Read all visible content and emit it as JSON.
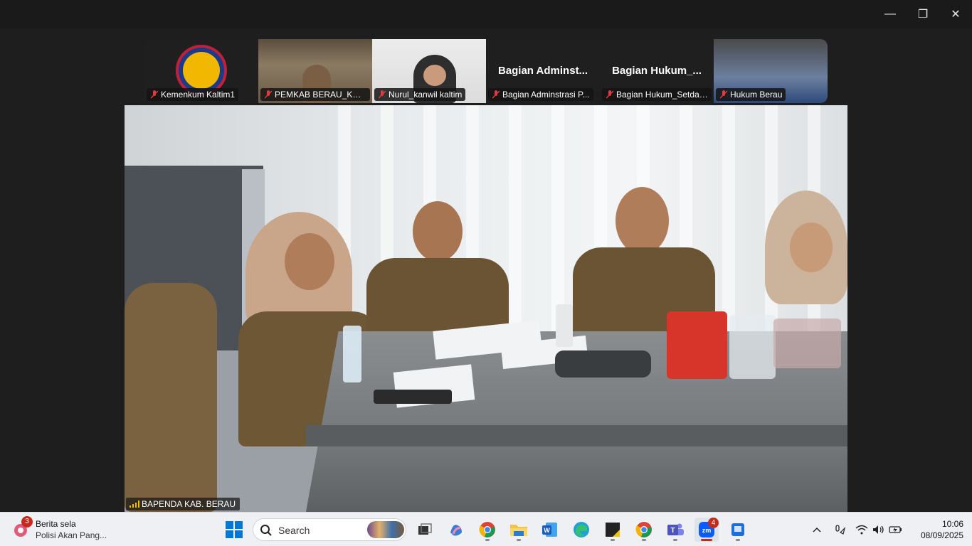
{
  "window": {
    "controls": {
      "minimize": "—",
      "maximize": "❐",
      "close": "✕"
    }
  },
  "thumbnails": [
    {
      "label": "Kemenkum Kaltim1",
      "muted": true,
      "kind": "logo"
    },
    {
      "label": "PEMKAB BERAU_KALT...",
      "muted": true,
      "kind": "video"
    },
    {
      "label": "Nurul_kanwil kaltim",
      "muted": true,
      "kind": "video"
    },
    {
      "big_name": "Bagian Adminst...",
      "label": "Bagian Adminstrasi P...",
      "muted": true,
      "kind": "name"
    },
    {
      "big_name": "Bagian Hukum_...",
      "label": "Bagian Hukum_Setda ...",
      "muted": true,
      "kind": "name"
    },
    {
      "label": "Hukum Berau",
      "muted": true,
      "kind": "video"
    }
  ],
  "speaker": {
    "label": "BAPENDA KAB. BERAU"
  },
  "taskbar": {
    "news": {
      "badge": "3",
      "title": "Berita sela",
      "subtitle": "Polisi Akan Pang..."
    },
    "search": {
      "placeholder": "Search"
    },
    "apps": [
      {
        "name": "task-view",
        "icon": "task-view-icon"
      },
      {
        "name": "copilot",
        "icon": "copilot-icon"
      },
      {
        "name": "chrome",
        "icon": "chrome-icon"
      },
      {
        "name": "file-explorer",
        "icon": "folder-icon"
      },
      {
        "name": "word",
        "icon": "word-icon"
      },
      {
        "name": "edge",
        "icon": "edge-icon"
      },
      {
        "name": "sticky",
        "icon": "sticky-icon"
      },
      {
        "name": "chrome-profile",
        "icon": "chrome-icon"
      },
      {
        "name": "teams",
        "icon": "teams-icon"
      },
      {
        "name": "zoom",
        "icon": "zoom-icon",
        "badge": "4",
        "active": true
      },
      {
        "name": "app-extra",
        "icon": "app-icon"
      }
    ],
    "clock": {
      "time": "10:06",
      "date": "08/09/2025"
    }
  },
  "colors": {
    "accent_red": "#c42b1c",
    "title_bar": "#1a1a1a",
    "taskbar": "#eef0f4"
  }
}
